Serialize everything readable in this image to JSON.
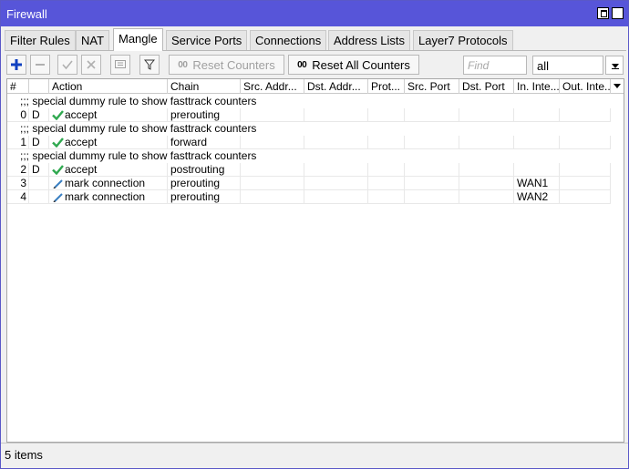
{
  "window": {
    "title": "Firewall"
  },
  "tabs": [
    {
      "label": "Filter Rules",
      "active": false
    },
    {
      "label": "NAT",
      "active": false
    },
    {
      "label": "Mangle",
      "active": true
    },
    {
      "label": "Service Ports",
      "active": false
    },
    {
      "label": "Connections",
      "active": false
    },
    {
      "label": "Address Lists",
      "active": false
    },
    {
      "label": "Layer7 Protocols",
      "active": false
    }
  ],
  "toolbar": {
    "add_icon": "plus-icon",
    "remove_icon": "minus-icon",
    "enable_icon": "check-icon",
    "disable_icon": "x-icon",
    "comment_icon": "comment-icon",
    "filter_icon": "funnel-icon",
    "reset_counters_prefix": "00",
    "reset_counters_label": "Reset Counters",
    "reset_all_counters_prefix": "00",
    "reset_all_counters_label": "Reset All Counters",
    "find_placeholder": "Find",
    "filter_value": "all"
  },
  "columns": [
    "#",
    "",
    "Action",
    "Chain",
    "Src. Addr...",
    "Dst. Addr...",
    "Prot...",
    "Src. Port",
    "Dst. Port",
    "In. Inte...",
    "Out. Inte..."
  ],
  "rows": [
    {
      "type": "comment",
      "text": ";;; special dummy rule to show fasttrack counters"
    },
    {
      "type": "rule",
      "num": "0",
      "flag": "D",
      "action_icon": "check-icon",
      "action": "accept",
      "chain": "prerouting",
      "in_iface": ""
    },
    {
      "type": "comment",
      "text": ";;; special dummy rule to show fasttrack counters"
    },
    {
      "type": "rule",
      "num": "1",
      "flag": "D",
      "action_icon": "check-icon",
      "action": "accept",
      "chain": "forward",
      "in_iface": ""
    },
    {
      "type": "comment",
      "text": ";;; special dummy rule to show fasttrack counters"
    },
    {
      "type": "rule",
      "num": "2",
      "flag": "D",
      "action_icon": "check-icon",
      "action": "accept",
      "chain": "postrouting",
      "in_iface": ""
    },
    {
      "type": "rule",
      "num": "3",
      "flag": "",
      "action_icon": "pencil-icon",
      "action": "mark connection",
      "chain": "prerouting",
      "in_iface": "WAN1"
    },
    {
      "type": "rule",
      "num": "4",
      "flag": "",
      "action_icon": "pencil-icon",
      "action": "mark connection",
      "chain": "prerouting",
      "in_iface": "WAN2"
    }
  ],
  "status": {
    "items_text": "5 items"
  },
  "colors": {
    "titlebar": "#5755d9",
    "accept_check": "#2fa84f",
    "pencil": "#3a7fc2",
    "add_plus": "#1040c0"
  }
}
